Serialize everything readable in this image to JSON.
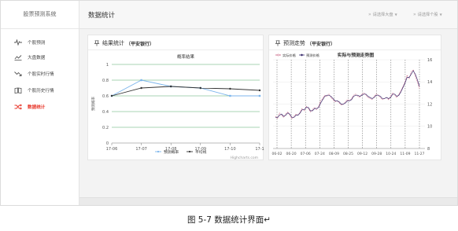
{
  "sidebar": {
    "title": "股票预测系统",
    "items": [
      {
        "label": "个股预测",
        "icon": "pulse-icon",
        "active": false
      },
      {
        "label": "大盘数据",
        "icon": "area-chart-icon",
        "active": false
      },
      {
        "label": "个股实时行情",
        "icon": "trend-down-icon",
        "active": false
      },
      {
        "label": "个股历史行情",
        "icon": "book-icon",
        "active": false
      },
      {
        "label": "数据统计",
        "icon": "shuffle-icon",
        "active": true
      }
    ]
  },
  "header": {
    "title": "数据统计",
    "select_market": "请选择大盘",
    "select_stock": "请选择个股"
  },
  "panels": {
    "left": {
      "title": "结果统计",
      "subtitle": "（平安银行）"
    },
    "right": {
      "title": "预测走势",
      "subtitle": "（平安银行）"
    }
  },
  "caption": "图 5-7 数据统计界面↵",
  "chart_data": [
    {
      "type": "line",
      "title": "概率结果",
      "xlabel": "",
      "ylabel": "预测概率",
      "categories": [
        "17-06",
        "17-07",
        "17-08",
        "17-09",
        "17-10",
        "17-1"
      ],
      "ylim": [
        0,
        1
      ],
      "yticks": [
        0,
        0.2,
        0.4,
        0.6,
        0.8,
        1
      ],
      "grid": true,
      "legend_position": "bottom-center",
      "series": [
        {
          "name": "预测概率",
          "color": "#7cb5ec",
          "values": [
            0.6,
            0.8,
            0.72,
            0.7,
            0.6,
            0.6
          ]
        },
        {
          "name": "平均线",
          "color": "#333333",
          "values": [
            0.6,
            0.7,
            0.72,
            0.7,
            0.69,
            0.67
          ]
        }
      ],
      "credits": "Highcharts.com"
    },
    {
      "type": "line",
      "title": "实际与预测走势图",
      "ylim": [
        8,
        16
      ],
      "yticks": [
        8,
        10,
        12,
        14,
        16
      ],
      "x_ticks": [
        "06-02",
        "06-20",
        "07-06",
        "07-24",
        "08-09",
        "08-25",
        "09-12",
        "09-28",
        "10-24",
        "11-09",
        "11-27"
      ],
      "grid": true,
      "legend_position": "top-left",
      "series": [
        {
          "name": "实际价格",
          "color": "#c7587a",
          "values": [
            10.9,
            10.7,
            11.2,
            11.0,
            10.8,
            11.1,
            11.3,
            11.0,
            10.7,
            10.9,
            11.1,
            11.0,
            11.3,
            11.6,
            11.4,
            11.8,
            11.6,
            11.3,
            11.5,
            11.7,
            11.5,
            11.8,
            12.3,
            12.5,
            12.8,
            12.7,
            12.9,
            12.6,
            12.4,
            12.2,
            12.3,
            12.1,
            11.9,
            12.0,
            12.2,
            12.4,
            12.3,
            12.5,
            12.8,
            12.9,
            12.7,
            12.6,
            12.9,
            13.0,
            12.8,
            12.6,
            12.5,
            12.4,
            12.7,
            12.9,
            12.8,
            12.6,
            12.4,
            12.5,
            12.6,
            12.4,
            12.7,
            13.0,
            12.8,
            12.6,
            12.9,
            13.2,
            13.6,
            14.0,
            14.6,
            14.3,
            14.9,
            15.1,
            14.5,
            14.0,
            13.4
          ]
        },
        {
          "name": "预测价格",
          "color": "#3b2d6e",
          "values": [
            10.8,
            10.8,
            11.0,
            11.1,
            10.9,
            11.0,
            11.2,
            11.1,
            10.8,
            10.8,
            11.0,
            11.0,
            11.2,
            11.5,
            11.5,
            11.7,
            11.7,
            11.4,
            11.4,
            11.6,
            11.6,
            11.7,
            12.1,
            12.4,
            12.7,
            12.8,
            12.8,
            12.7,
            12.5,
            12.3,
            12.3,
            12.2,
            12.0,
            12.0,
            12.1,
            12.3,
            12.3,
            12.4,
            12.7,
            12.8,
            12.8,
            12.7,
            12.8,
            12.9,
            12.9,
            12.7,
            12.6,
            12.5,
            12.6,
            12.8,
            12.8,
            12.7,
            12.5,
            12.5,
            12.6,
            12.5,
            12.6,
            12.9,
            12.9,
            12.7,
            12.8,
            13.1,
            13.5,
            13.9,
            14.4,
            14.4,
            14.7,
            15.0,
            14.7,
            14.2,
            13.6
          ]
        }
      ]
    }
  ]
}
